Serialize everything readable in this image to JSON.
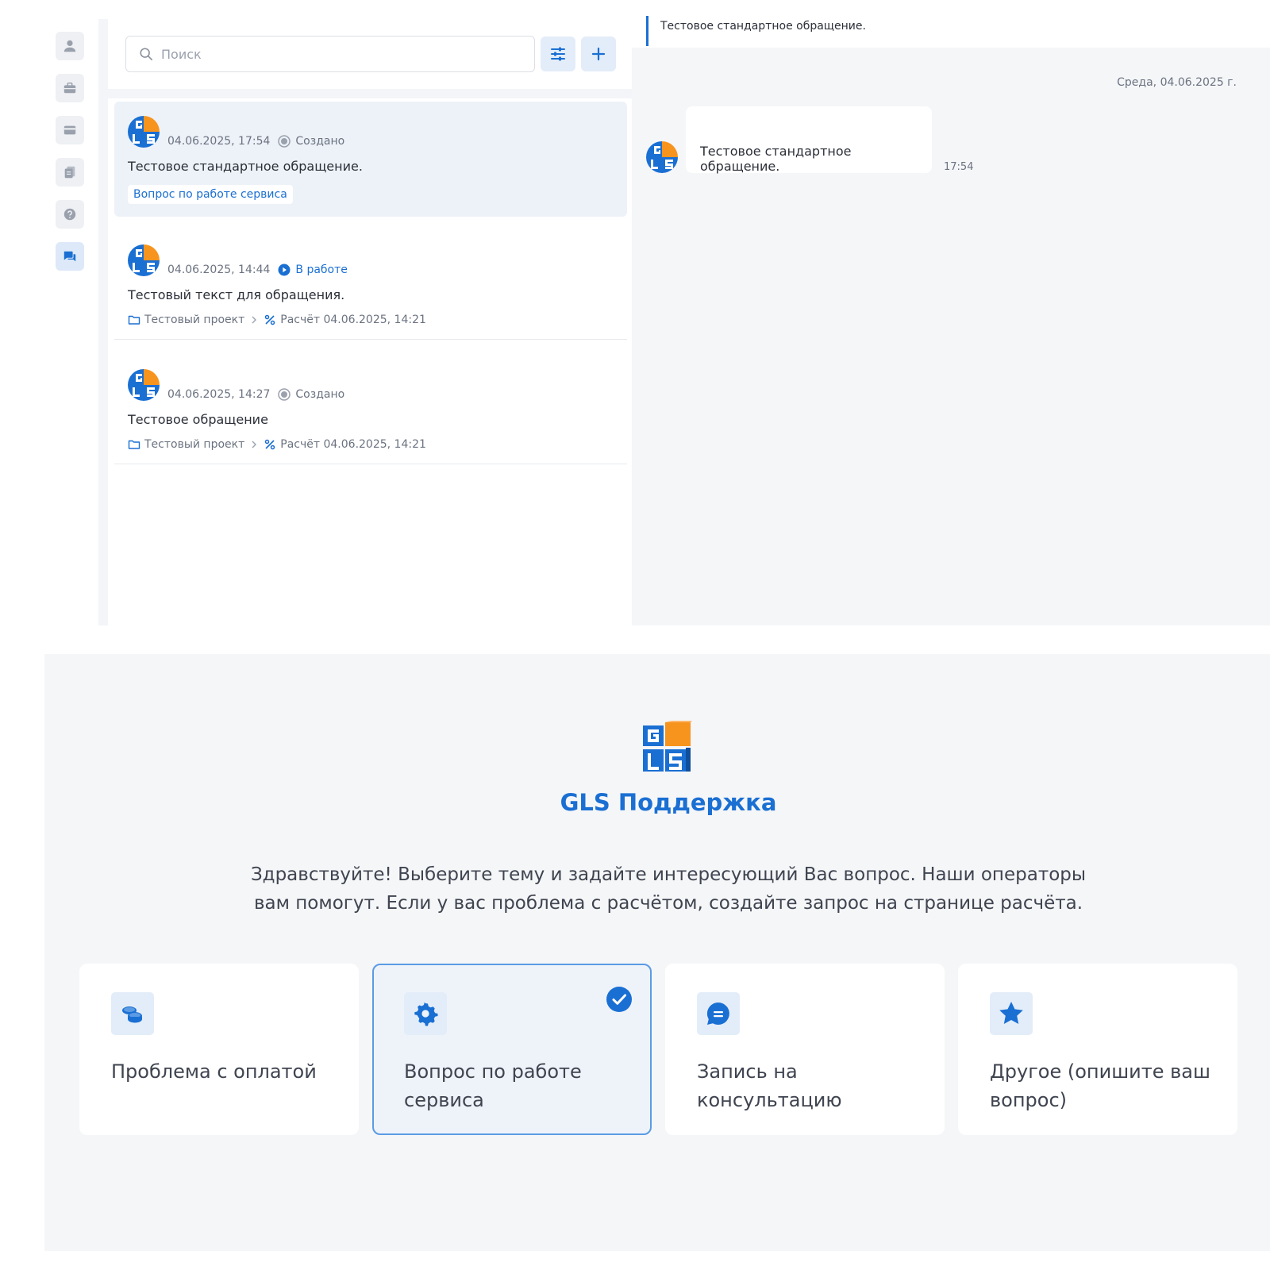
{
  "sidebar": {
    "items": [
      {
        "icon": "user-icon",
        "active": false
      },
      {
        "icon": "briefcase-icon",
        "active": false
      },
      {
        "icon": "card-icon",
        "active": false
      },
      {
        "icon": "documents-icon",
        "active": false
      },
      {
        "icon": "help-icon",
        "active": false
      },
      {
        "icon": "chat-icon",
        "active": true
      }
    ]
  },
  "search": {
    "placeholder": "Поиск"
  },
  "tickets": [
    {
      "date": "04.06.2025, 17:54",
      "status": "Создано",
      "title": "Тестовое стандартное обращение.",
      "tag": "Вопрос по работе сервиса"
    },
    {
      "date": "04.06.2025, 14:44",
      "status": "В работе",
      "title": "Тестовый текст для обращения.",
      "project": "Тестовый проект",
      "calculation": "Расчёт 04.06.2025, 14:21"
    },
    {
      "date": "04.06.2025, 14:27",
      "status": "Создано",
      "title": "Тестовое обращение",
      "project": "Тестовый проект",
      "calculation": "Расчёт 04.06.2025, 14:21"
    }
  ],
  "chat": {
    "quoted": "Тестовое стандартное обращение.",
    "day": "Среда, 04.06.2025 г.",
    "message": "Тестовое стандартное обращение.",
    "time": "17:54"
  },
  "support": {
    "title": "GLS Поддержка",
    "intro_line1": "Здравствуйте! Выберите тему и задайте интересующий Вас вопрос. Наши операторы",
    "intro_line2": "вам помогут. Если у вас проблема с расчётом, создайте запрос на странице расчёта.",
    "topics": [
      {
        "icon": "coins-icon",
        "label": "Проблема с оплатой",
        "selected": false
      },
      {
        "icon": "gear-icon",
        "label": "Вопрос по работе сервиса",
        "selected": true
      },
      {
        "icon": "message-icon",
        "label": "Запись на консультацию",
        "selected": false
      },
      {
        "icon": "star-icon",
        "label": "Другое (опишите ваш вопрос)",
        "selected": false
      }
    ]
  },
  "colors": {
    "accent": "#1a6fd3",
    "logo_orange": "#f7941d",
    "panel_bg": "#f5f6f8"
  }
}
